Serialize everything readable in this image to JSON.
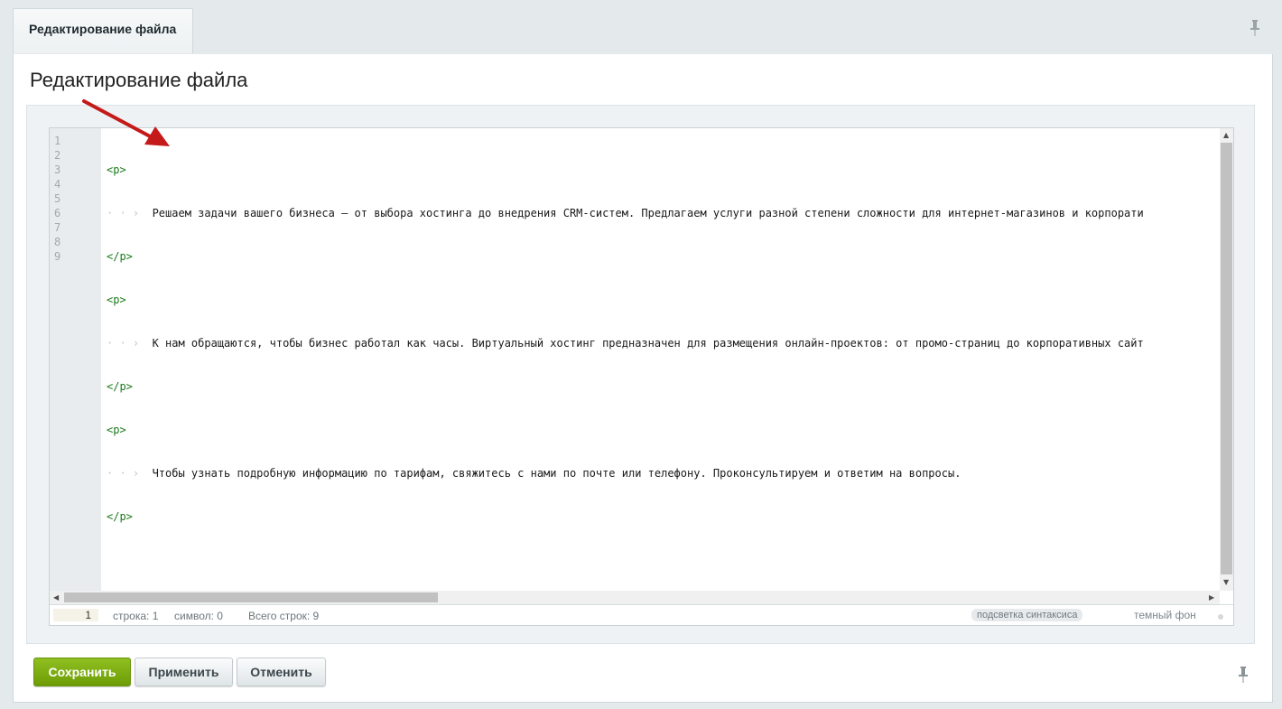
{
  "tab": {
    "label": "Редактирование файла"
  },
  "page": {
    "title": "Редактирование файла"
  },
  "editor": {
    "line_numbers": [
      "1",
      "2",
      "3",
      "4",
      "5",
      "6",
      "7",
      "8",
      "9"
    ],
    "lines": [
      {
        "indent": "",
        "tag": "<p>",
        "text": ""
      },
      {
        "indent": "· · ›  ",
        "tag": "",
        "text": "Решаем задачи вашего бизнеса — от выбора хостинга до внедрения CRM-систем. Предлагаем услуги разной степени сложности для интернет-магазинов и корпорати"
      },
      {
        "indent": "",
        "tag": "</p>",
        "text": ""
      },
      {
        "indent": "",
        "tag": "<p>",
        "text": ""
      },
      {
        "indent": "· · ›  ",
        "tag": "",
        "text": "К нам обращаются, чтобы бизнес работал как часы. Виртуальный хостинг предназначен для размещения онлайн-проектов: от промо-страниц до корпоративных сайт"
      },
      {
        "indent": "",
        "tag": "</p>",
        "text": ""
      },
      {
        "indent": "",
        "tag": "<p>",
        "text": ""
      },
      {
        "indent": "· · ›  ",
        "tag": "",
        "text": "Чтобы узнать подробную информацию по тарифам, свяжитесь с нами по почте или телефону. Проконсультируем и ответим на вопросы."
      },
      {
        "indent": "",
        "tag": "</p>",
        "text": ""
      }
    ]
  },
  "statusbar": {
    "goto_line_value": "1",
    "row": "строка: 1",
    "symbol": "символ: 0",
    "total": "Всего строк: 9",
    "syntax": "подсветка синтаксиса",
    "dark": "темный фон"
  },
  "buttons": {
    "save": "Сохранить",
    "apply": "Применить",
    "cancel": "Отменить"
  },
  "colors": {
    "save_button": "#7aab10",
    "annotation_arrow": "#c41a1a",
    "tag": "#1a7a1a"
  },
  "icons": [
    "pin-icon",
    "annotation-arrow"
  ]
}
